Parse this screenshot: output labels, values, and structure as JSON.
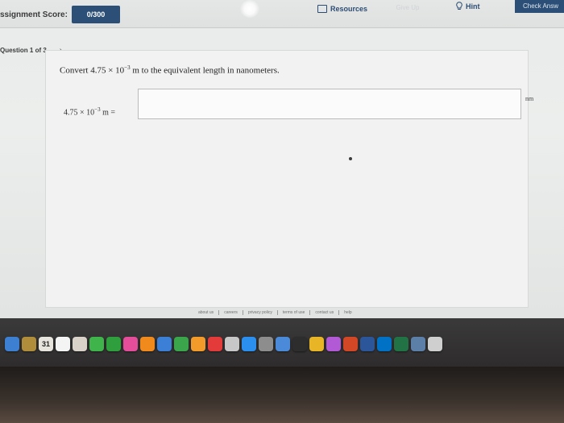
{
  "topbar": {
    "score_label": "ssignment Score:",
    "score_value": "0/300",
    "resources_label": "Resources",
    "faded_tab_label": "Give Up",
    "hint_label": "Hint",
    "check_label": "Check Answ"
  },
  "question_nav": {
    "label": "Question 1 of 3",
    "next": "›"
  },
  "question": {
    "prompt_pre": "Convert 4.75 × 10",
    "prompt_exp": "−3",
    "prompt_post": " m to the equivalent length in nanometers.",
    "eq_pre": "4.75 × 10",
    "eq_exp": "−3",
    "eq_post": " m =",
    "answer_value": "",
    "unit": "nm"
  },
  "footer": {
    "links": [
      "about us",
      "careers",
      "privacy policy",
      "terms of use",
      "contact us",
      "help"
    ]
  },
  "dock": {
    "calendar_day": "31",
    "icons": [
      {
        "name": "finder-icon",
        "color": "#3d7fd1"
      },
      {
        "name": "notes-icon",
        "color": "#b08d3a"
      },
      {
        "name": "calendar-icon",
        "color": "#e7e3dd"
      },
      {
        "name": "reminders-icon",
        "color": "#f4f4f4"
      },
      {
        "name": "photos-icon",
        "color": "#d8d2c8"
      },
      {
        "name": "messages-icon",
        "color": "#3fb44a"
      },
      {
        "name": "facetime-icon",
        "color": "#2f9e3c"
      },
      {
        "name": "itunes-icon",
        "color": "#e34d9a"
      },
      {
        "name": "ibooks-icon",
        "color": "#f08a1c"
      },
      {
        "name": "keynote-icon",
        "color": "#3b7fd6"
      },
      {
        "name": "numbers-icon",
        "color": "#3aa54a"
      },
      {
        "name": "pages-icon",
        "color": "#f29b2a"
      },
      {
        "name": "do-not-disturb-icon",
        "color": "#e33a3a"
      },
      {
        "name": "help-icon",
        "color": "#c7c7c7"
      },
      {
        "name": "app-store-icon",
        "color": "#2b8ff0"
      },
      {
        "name": "system-prefs-icon",
        "color": "#8d8d8d"
      },
      {
        "name": "preview-icon",
        "color": "#4a8ad8"
      },
      {
        "name": "play-icon",
        "color": "#2d2d2d"
      },
      {
        "name": "chrome-icon",
        "color": "#e7b526"
      },
      {
        "name": "colorful-app-icon",
        "color": "#b25ad6"
      },
      {
        "name": "powerpoint-icon",
        "color": "#d24726"
      },
      {
        "name": "word-icon",
        "color": "#2b579a"
      },
      {
        "name": "outlook-icon",
        "color": "#0072c6"
      },
      {
        "name": "excel-icon",
        "color": "#217346"
      },
      {
        "name": "downloads-icon",
        "color": "#5c7fa8"
      },
      {
        "name": "trash-icon",
        "color": "#cfcfcf"
      }
    ]
  }
}
